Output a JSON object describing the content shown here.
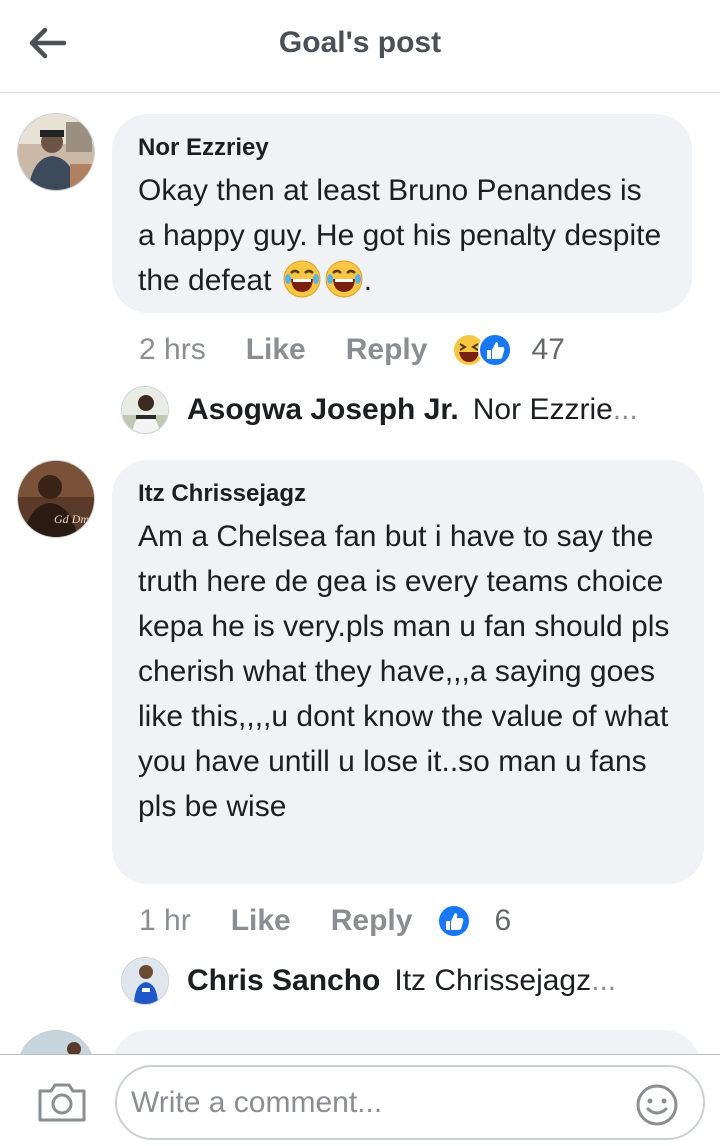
{
  "header": {
    "title": "Goal's post"
  },
  "comments": [
    {
      "author": "Nor Ezzriey",
      "text": "Okay then at least Bruno Penandes is a happy guy. He got his penalty despite the defeat",
      "trailing": ".",
      "time": "2 hrs",
      "like_label": "Like",
      "reply_label": "Reply",
      "reaction_count": "47",
      "reply_preview": {
        "name": "Asogwa Joseph Jr.",
        "text": "Nor Ezzrie",
        "ellipsis": "..."
      }
    },
    {
      "author": "Itz Chrissejagz",
      "text": "Am a Chelsea fan but i have to say the truth here de gea is every teams choice kepa he is very.pls man u fan should pls cherish what they have,,,a saying goes like this,,,,u dont know the value of what you have untill u lose it..so man u fans pls be wise",
      "time": "1 hr",
      "like_label": "Like",
      "reply_label": "Reply",
      "reaction_count": "6",
      "reply_preview": {
        "name": "Chris Sancho",
        "text": "Itz Chrissejagz",
        "ellipsis": "..."
      }
    }
  ],
  "composer": {
    "placeholder": "Write a comment..."
  },
  "colors": {
    "like_blue": "#1877f2",
    "haha_yellow": "#f7c744",
    "bubble_bg": "#f0f2f5",
    "meta_gray": "#8a8d91"
  },
  "icons": [
    "back-arrow-icon",
    "haha-reaction-icon",
    "like-reaction-icon",
    "camera-icon",
    "emoji-smile-icon"
  ]
}
